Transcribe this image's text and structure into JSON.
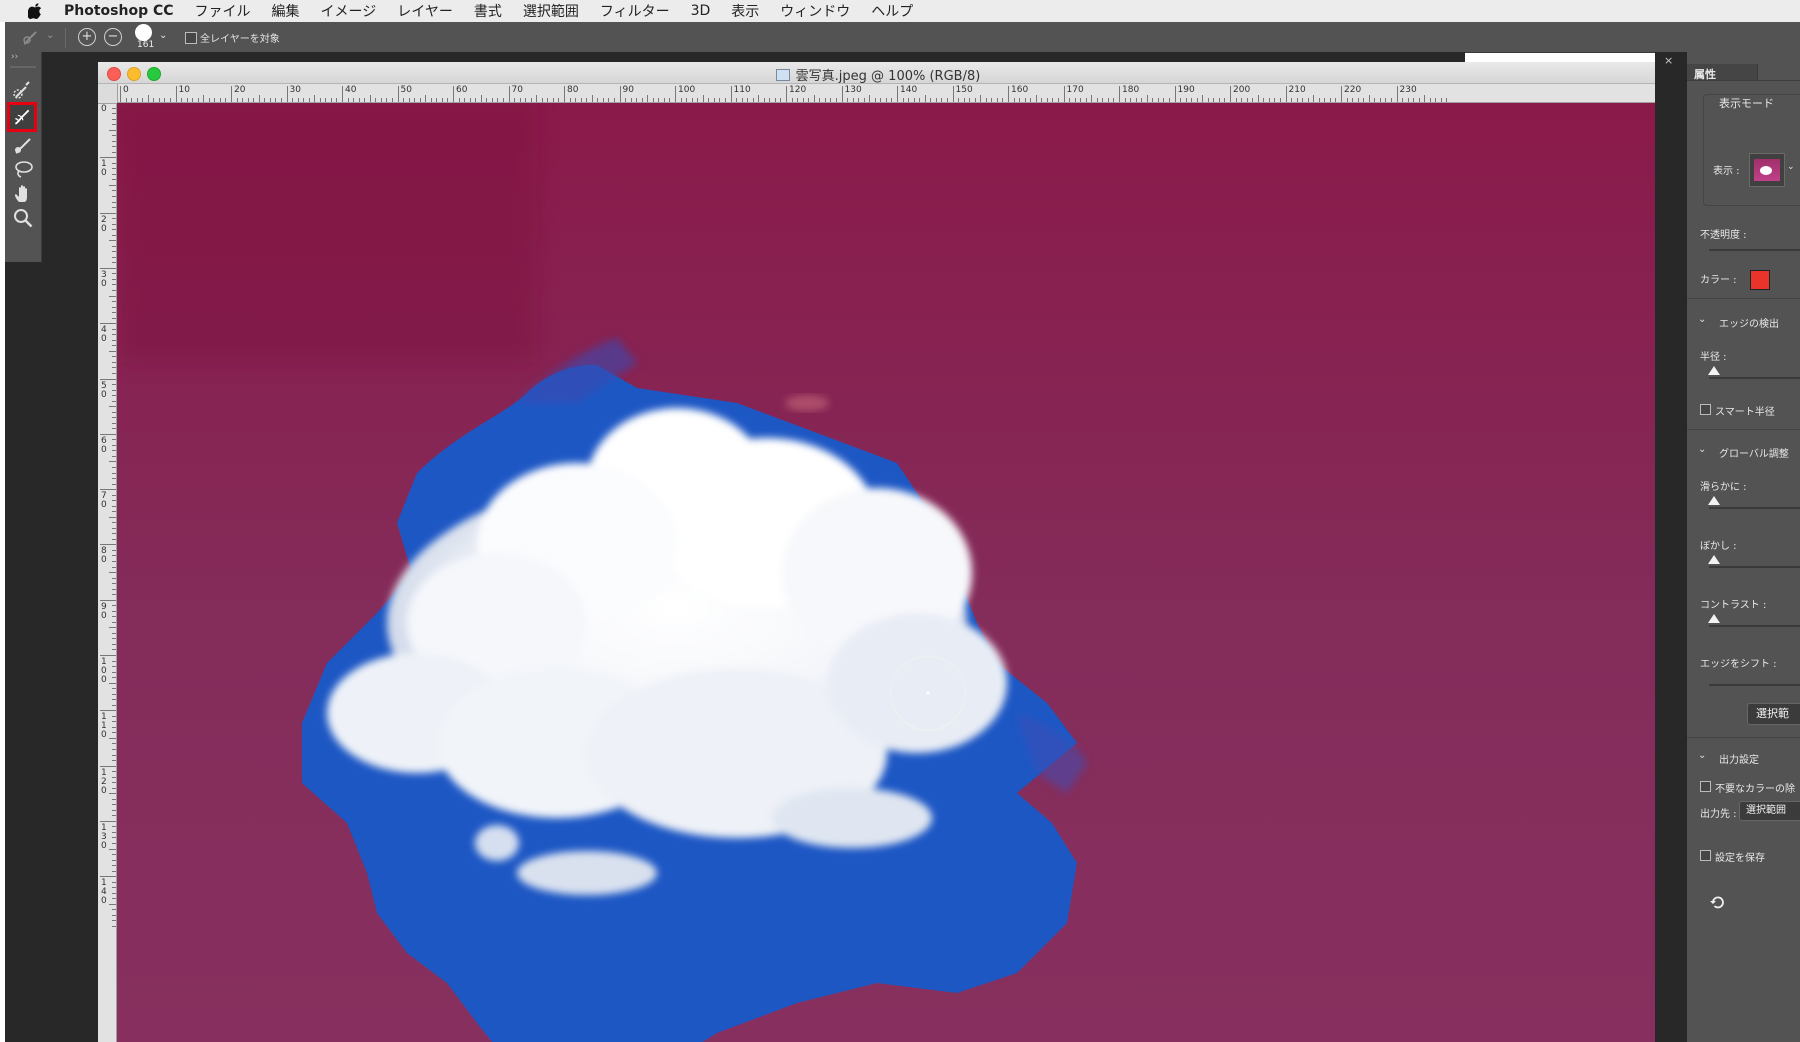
{
  "menubar": {
    "app_name": "Photoshop CC",
    "items": [
      "ファイル",
      "編集",
      "イメージ",
      "レイヤー",
      "書式",
      "選択範囲",
      "フィルター",
      "3D",
      "表示",
      "ウィンドウ",
      "ヘルプ"
    ]
  },
  "options_bar": {
    "brush_size": "161",
    "all_layers_label": "全レイヤーを対象"
  },
  "tools": [
    "quick-selection-icon",
    "refine-edge-brush-icon",
    "brush-icon",
    "lasso-icon",
    "hand-icon",
    "zoom-icon"
  ],
  "document": {
    "title": "雲写真.jpeg @ 100% (RGB/8)",
    "ruler_h": [
      "0",
      "10",
      "20",
      "30",
      "40",
      "50",
      "60",
      "70",
      "80",
      "90",
      "100",
      "110",
      "120",
      "130",
      "140",
      "150",
      "160",
      "170",
      "180",
      "190",
      "200",
      "210",
      "220",
      "230"
    ],
    "ruler_v": [
      "0",
      "1 0",
      "2 0",
      "3 0",
      "4 0",
      "5 0",
      "6 0",
      "7 0",
      "8 0",
      "9 0",
      "1 0 0",
      "1 1 0",
      "1 2 0",
      "1 3 0",
      "1 4 0"
    ]
  },
  "properties": {
    "tab": "属性",
    "view_mode_header": "表示モード",
    "view_label": "表示 :",
    "opacity_label": "不透明度 :",
    "color_label": "カラー :",
    "color_swatch": "#e8342a",
    "edge_detection_header": "エッジの検出",
    "radius_label": "半径 :",
    "smart_radius_label": "スマート半径",
    "global_adjust_header": "グローバル調整",
    "smooth_label": "滑らかに :",
    "feather_label": "ぼかし :",
    "contrast_label": "コントラスト :",
    "shift_edge_label": "エッジをシフト :",
    "selection_button": "選択範",
    "output_header": "出力設定",
    "decontaminate_label": "不要なカラーの除",
    "output_to_label": "出力先 :",
    "output_to_value": "選択範囲",
    "save_settings_label": "設定を保存"
  }
}
